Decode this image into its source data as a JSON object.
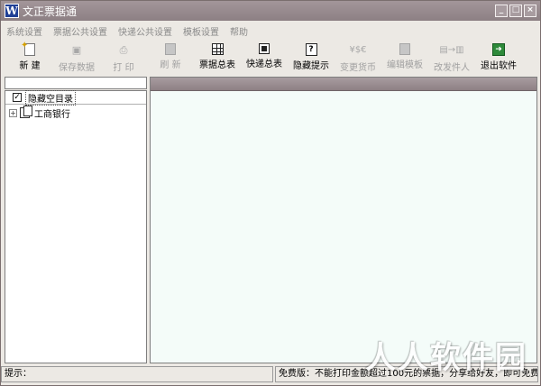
{
  "window": {
    "title": "文正票据通",
    "app_icon_letter": "W"
  },
  "menu": [
    "系统设置",
    "票据公共设置",
    "快递公共设置",
    "模板设置",
    "帮助"
  ],
  "toolbar": [
    {
      "label": "新 建",
      "icon": "new-document-icon",
      "enabled": true
    },
    {
      "label": "保存数据",
      "icon": "save-icon",
      "enabled": false
    },
    {
      "label": "打 印",
      "icon": "print-icon",
      "enabled": false
    },
    {
      "label": "刷 新",
      "icon": "refresh-icon",
      "enabled": false
    },
    {
      "label": "票据总表",
      "icon": "grid-table-icon",
      "enabled": true
    },
    {
      "label": "快递总表",
      "icon": "express-table-icon",
      "enabled": true
    },
    {
      "label": "隐藏提示",
      "icon": "help-tip-icon",
      "enabled": true
    },
    {
      "label": "变更货币",
      "icon": "currency-icon",
      "enabled": false
    },
    {
      "label": "编辑模板",
      "icon": "edit-template-icon",
      "enabled": false
    },
    {
      "label": "改发件人",
      "icon": "change-sender-icon",
      "enabled": false
    },
    {
      "label": "退出软件",
      "icon": "exit-icon",
      "enabled": true
    }
  ],
  "left_pane": {
    "search_value": "",
    "hide_empty_label": "隐藏空目录",
    "hide_empty_checked": true,
    "tree_items": [
      {
        "label": "工商银行",
        "expander": "+"
      }
    ]
  },
  "status": {
    "left": "提示：",
    "right": "免费版：不能打印金额超过100元的票据，分享给好友，即可免费"
  },
  "watermark": "人人软件园",
  "colors": {
    "title_bar": "#8d8084",
    "content_bg": "#f4fcf9"
  }
}
